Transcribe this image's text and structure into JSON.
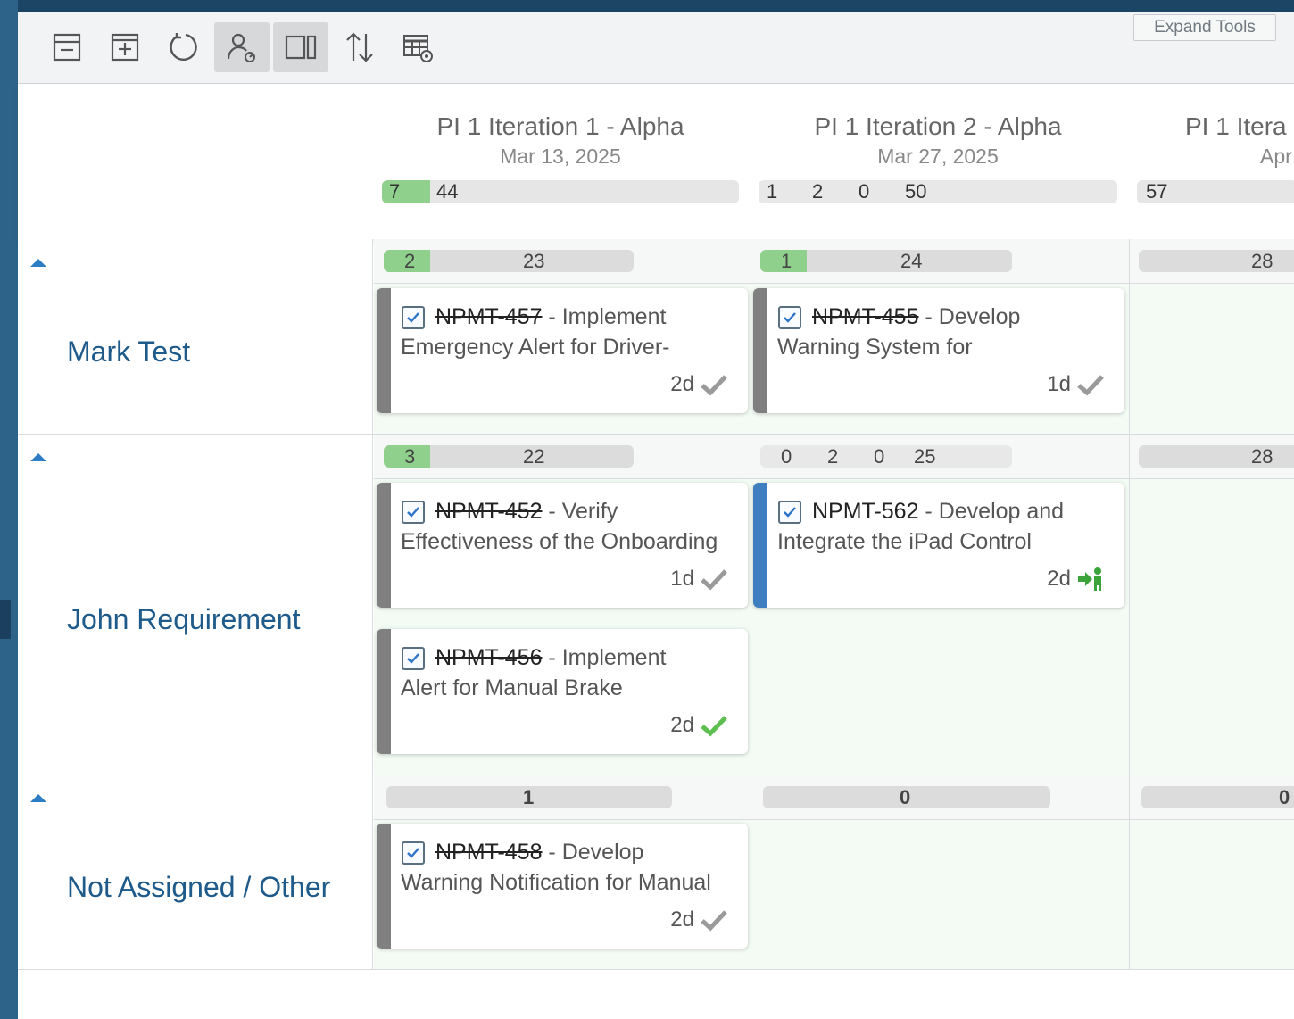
{
  "toolbar": {
    "buttons": [
      {
        "icon": "collapse-all-icon",
        "active": false
      },
      {
        "icon": "expand-all-icon",
        "active": false
      },
      {
        "icon": "refresh-icon",
        "active": false
      },
      {
        "icon": "user-capacity-icon",
        "active": true
      },
      {
        "icon": "split-view-icon",
        "active": true
      },
      {
        "icon": "sort-icon",
        "active": false
      },
      {
        "icon": "table-settings-icon",
        "active": false
      }
    ],
    "expand_tools_label": "Expand Tools"
  },
  "iterations": [
    {
      "title": "PI 1 Iteration 1 - Alpha",
      "date": "Mar 13, 2025",
      "bar": [
        "7",
        "44"
      ]
    },
    {
      "title": "PI 1 Iteration 2 - Alpha",
      "date": "Mar 27, 2025",
      "bar": [
        "1",
        "2",
        "0",
        "50"
      ]
    },
    {
      "title": "PI 1 Itera",
      "date": "Apr",
      "bar": [
        "57"
      ]
    }
  ],
  "lanes": [
    {
      "name": "Mark Test",
      "cells": [
        {
          "bar": [
            "2",
            "23"
          ]
        },
        {
          "bar": [
            "1",
            "24"
          ]
        },
        {
          "bar": [
            "28"
          ]
        }
      ]
    },
    {
      "name": "John Requirement",
      "cells": [
        {
          "bar": [
            "3",
            "22"
          ]
        },
        {
          "bar": [
            "0",
            "2",
            "0",
            "25"
          ]
        },
        {
          "bar": [
            "28"
          ]
        }
      ]
    },
    {
      "name": "Not Assigned / Other",
      "cells": [
        {
          "bar": [
            "1"
          ]
        },
        {
          "bar": [
            "0"
          ]
        },
        {
          "bar": [
            "0"
          ]
        }
      ]
    }
  ],
  "cards": [
    {
      "id": "NPMT-457",
      "title_first": " - Implement",
      "title_second": "Emergency Alert for Driver-",
      "estimate": "2d",
      "status": "done-gray-check-icon"
    },
    {
      "id": "NPMT-455",
      "title_first": " - Develop",
      "title_second": "Warning System for",
      "estimate": "1d",
      "status": "done-gray-check-icon"
    },
    {
      "id": "NPMT-452",
      "title_first": " - Verify",
      "title_second": "Effectiveness of the Onboarding",
      "estimate": "1d",
      "status": "done-gray-check-icon"
    },
    {
      "id": "NPMT-562",
      "title_first": " - Develop and",
      "title_second": "Integrate the iPad Control",
      "estimate": "2d",
      "status": "in-progress-user-icon"
    },
    {
      "id": "NPMT-456",
      "title_first": " - Implement",
      "title_second": "Alert for Manual Brake",
      "estimate": "2d",
      "status": "done-green-check-icon"
    },
    {
      "id": "NPMT-458",
      "title_first": " - Develop",
      "title_second": "Warning Notification for Manual",
      "estimate": "2d",
      "status": "done-gray-check-icon"
    }
  ],
  "colors": {
    "accent_blue": "#1e5a8a",
    "green_bar": "#8fd18c",
    "cell_background": "#f3fbf4"
  }
}
